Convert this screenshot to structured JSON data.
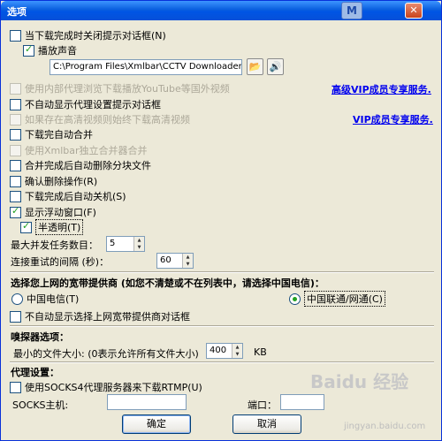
{
  "window": {
    "title": "选项",
    "close_glyph": "✕",
    "app_glyph": "M"
  },
  "options": {
    "close_prompt": "当下载完成时关闭提示对话框(N)",
    "play_sound": "播放声音",
    "sound_path": "C:\\Program Files\\Xmlbar\\CCTV Downloader\\sound",
    "internal_proxy": "使用内部代理浏览下载播放YouTube等国外视频",
    "internal_proxy_link": "高级VIP成员专享服务.",
    "no_proxy_prompt": "不自动显示代理设置提示对话框",
    "hd_download": "如果存在高清视频则始终下载高清视频",
    "hd_link": "VIP成员专享服务.",
    "auto_merge": "下载完自动合并",
    "standalone_merger": "使用Xmlbar独立合并器合并",
    "delete_parts": "合并完成后自动删除分块文件",
    "confirm_delete": "确认删除操作(R)",
    "auto_shutdown": "下载完成后自动关机(S)",
    "float_window": "显示浮动窗口(F)",
    "translucent": "半透明(T)"
  },
  "tasks": {
    "max_tasks_label": "最大并发任务数目：",
    "max_tasks_value": "5",
    "retry_label": "连接重试的间隔 (秒)：",
    "retry_value": "60"
  },
  "isp": {
    "heading": "选择您上网的宽带提供商 (如您不清楚或不在列表中，请选择中国电信)：",
    "telecom": "中国电信(T)",
    "unicom": "中国联通/网通(C)",
    "no_isp_prompt": "不自动显示选择上网宽带提供商对话框"
  },
  "sniffer": {
    "heading": "嗅探器选项：",
    "min_size_label": "最小的文件大小: (0表示允许所有文件大小)",
    "min_size_value": "400",
    "unit": "KB"
  },
  "proxy": {
    "heading": "代理设置：",
    "socks4": "使用SOCKS4代理服务器来下载RTMP(U)",
    "host_label": "SOCKS主机:",
    "port_label": "端口："
  },
  "buttons": {
    "ok": "确定",
    "cancel": "取消"
  },
  "watermark": {
    "brand": "Baidu 经验",
    "url": "jingyan.baidu.com"
  }
}
